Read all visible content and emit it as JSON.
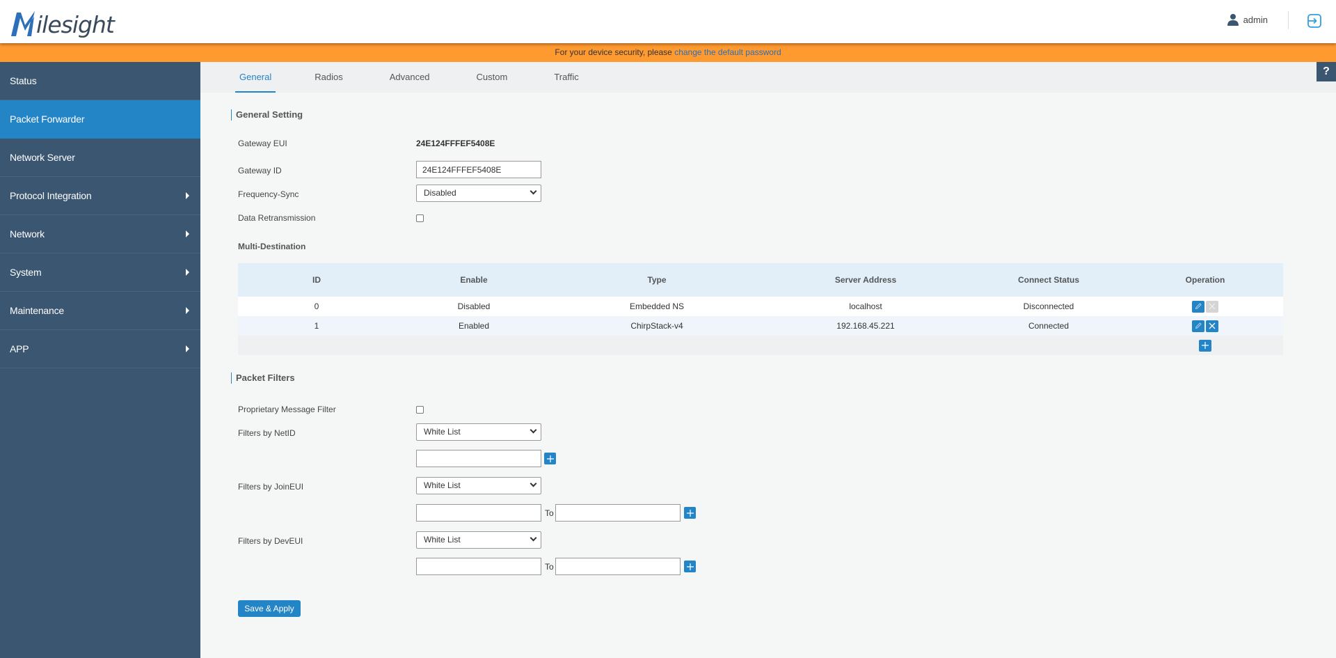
{
  "header": {
    "brand": "ilesight",
    "user": "admin"
  },
  "notice": {
    "text": "For your device security, please ",
    "link": "change the default password"
  },
  "sidebar": {
    "items": [
      {
        "label": "Status",
        "submenu": false
      },
      {
        "label": "Packet Forwarder",
        "submenu": false,
        "active": true
      },
      {
        "label": "Network Server",
        "submenu": false
      },
      {
        "label": "Protocol Integration",
        "submenu": true
      },
      {
        "label": "Network",
        "submenu": true
      },
      {
        "label": "System",
        "submenu": true
      },
      {
        "label": "Maintenance",
        "submenu": true
      },
      {
        "label": "APP",
        "submenu": true
      }
    ]
  },
  "tabs": [
    "General",
    "Radios",
    "Advanced",
    "Custom",
    "Traffic"
  ],
  "active_tab": "General",
  "help_label": "?",
  "general": {
    "title": "General Setting",
    "gateway_eui_label": "Gateway EUI",
    "gateway_eui": "24E124FFFEF5408E",
    "gateway_id_label": "Gateway ID",
    "gateway_id": "24E124FFFEF5408E",
    "freq_sync_label": "Frequency-Sync",
    "freq_sync": "Disabled",
    "data_retx_label": "Data Retransmission",
    "data_retx_checked": false,
    "multi_dest_label": "Multi-Destination"
  },
  "table": {
    "headers": [
      "ID",
      "Enable",
      "Type",
      "Server Address",
      "Connect Status",
      "Operation"
    ],
    "rows": [
      {
        "id": "0",
        "enable": "Disabled",
        "type": "Embedded NS",
        "address": "localhost",
        "status": "Disconnected",
        "deletable": false
      },
      {
        "id": "1",
        "enable": "Enabled",
        "type": "ChirpStack-v4",
        "address": "192.168.45.221",
        "status": "Connected",
        "deletable": true
      }
    ]
  },
  "filters": {
    "title": "Packet Filters",
    "proprietary_label": "Proprietary Message Filter",
    "proprietary_checked": false,
    "netid_label": "Filters by NetID",
    "netid_mode": "White List",
    "netid_value": "",
    "joineui_label": "Filters by JoinEUI",
    "joineui_mode": "White List",
    "joineui_from": "",
    "joineui_to": "",
    "deveui_label": "Filters by DevEUI",
    "deveui_mode": "White List",
    "deveui_from": "",
    "deveui_to": "",
    "to_label": "To"
  },
  "save_label": "Save & Apply",
  "colors": {
    "accent": "#2384c6",
    "sidebar": "#3b5671",
    "notice": "#ff9a30"
  }
}
